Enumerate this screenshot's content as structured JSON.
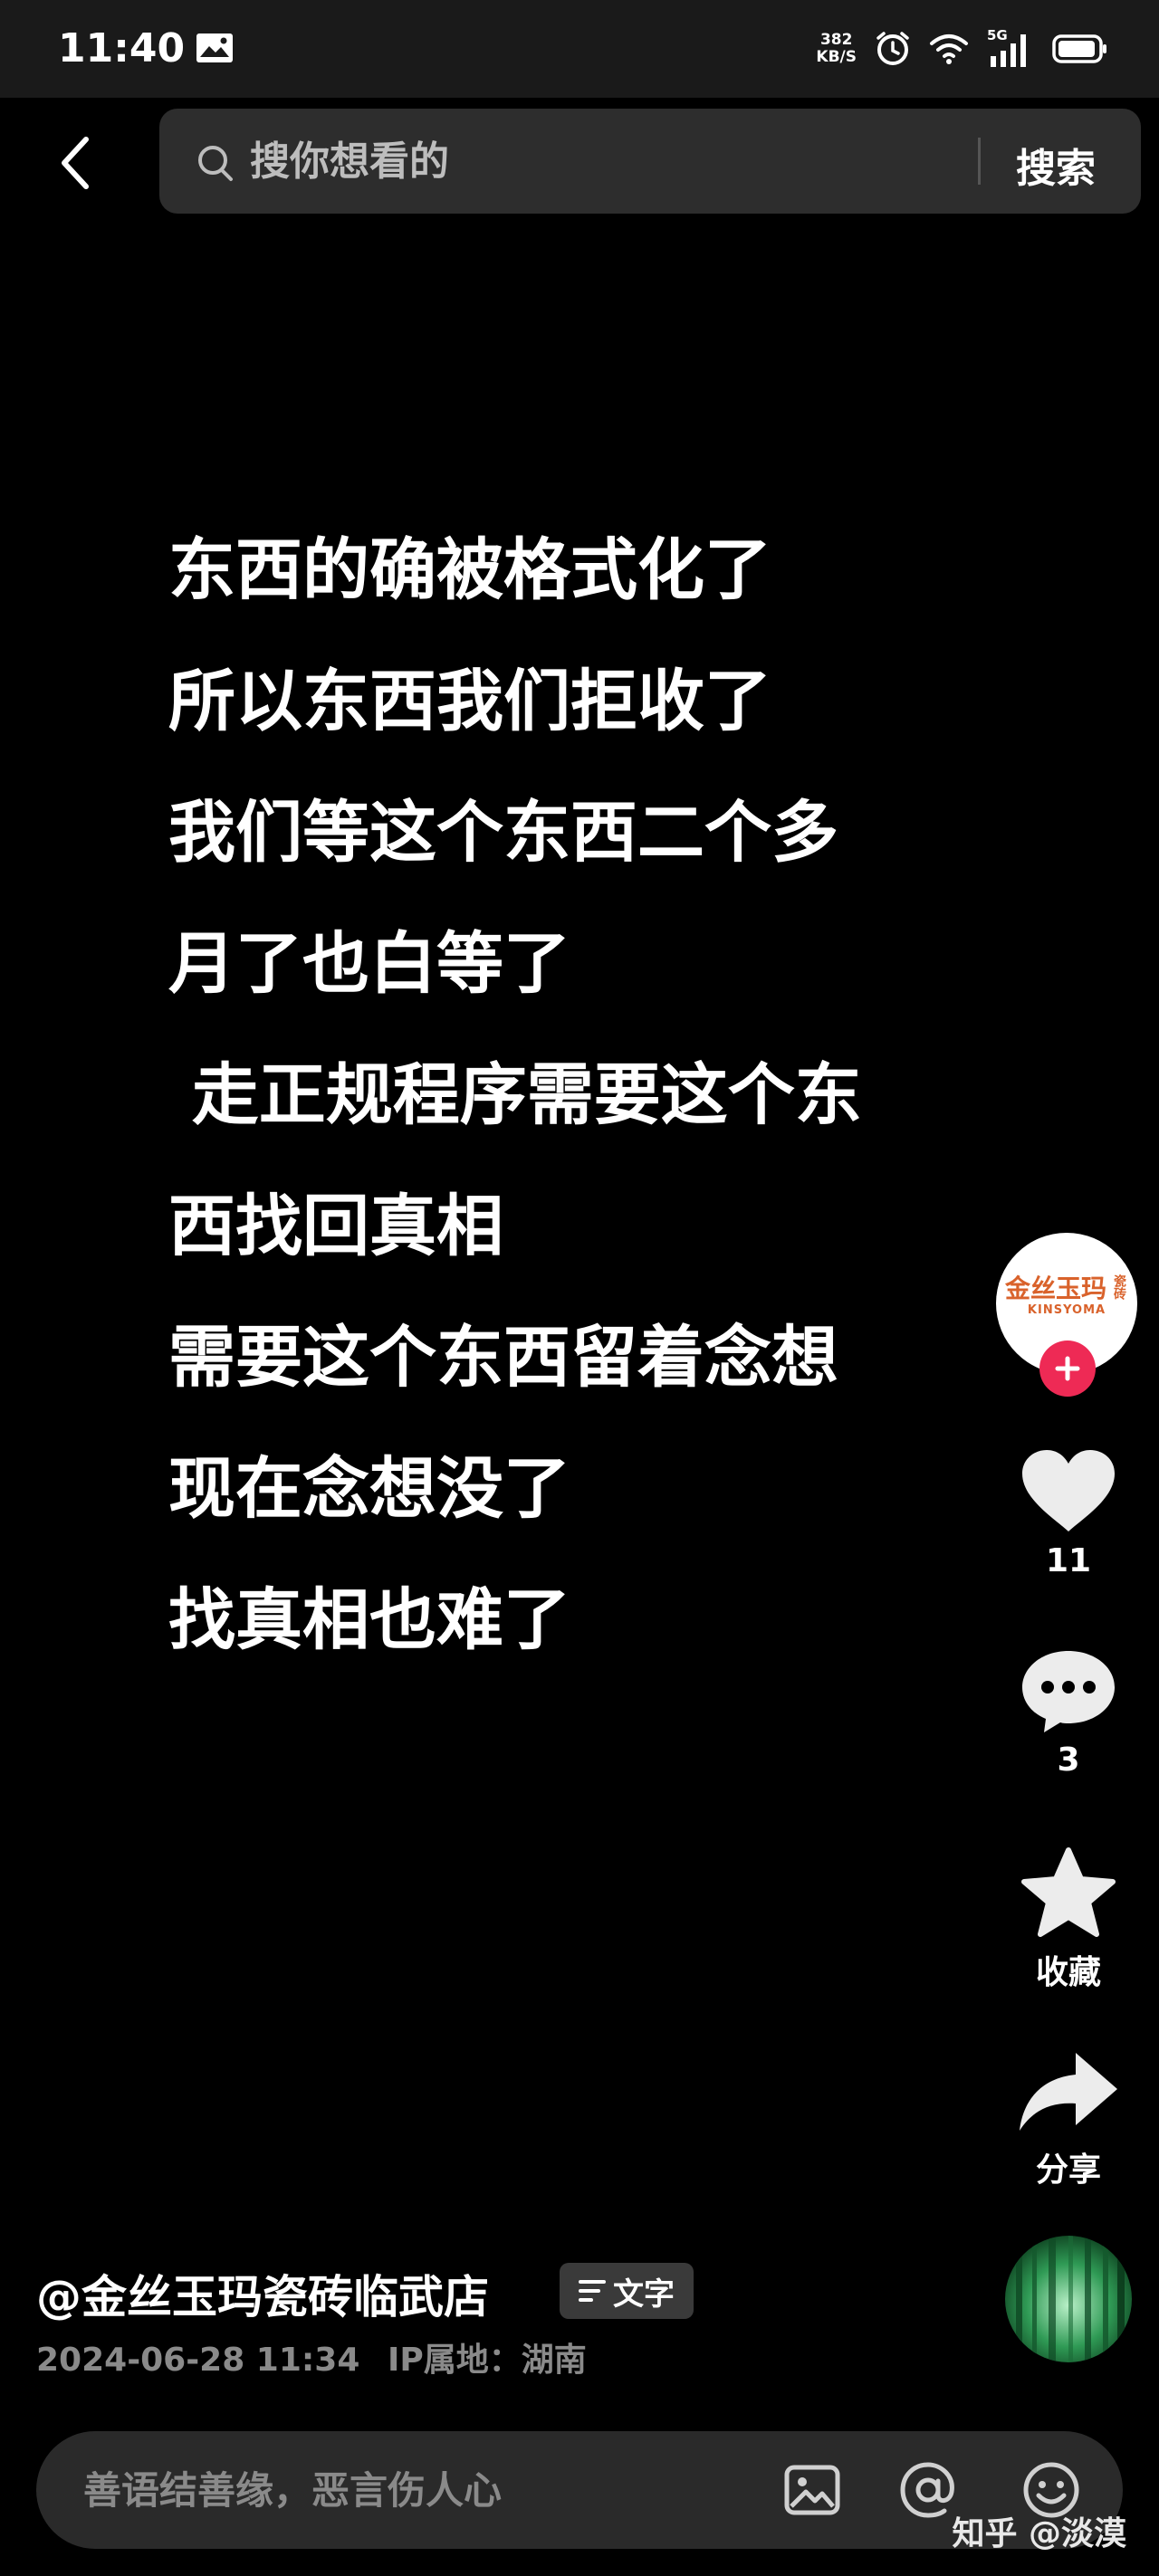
{
  "status_bar": {
    "time": "11:40",
    "net_speed_value": "382",
    "net_speed_unit": "KB/S",
    "network_type": "5G",
    "icons": [
      "gallery-icon",
      "alarm-icon",
      "wifi-icon",
      "signal-icon",
      "battery-icon"
    ]
  },
  "header": {
    "search_placeholder": "搜你想看的",
    "search_button_label": "搜索"
  },
  "content": {
    "lines": [
      "东西的确被格式化了",
      "所以东西我们拒收了",
      "我们等这个东西二个多",
      "月了也白等了",
      " 走正规程序需要这个东",
      "西找回真相",
      "需要这个东西留着念想",
      "现在念想没了",
      "找真相也难了"
    ]
  },
  "sidebar": {
    "avatar_logo_text": "金丝玉玛",
    "avatar_logo_sub": "KINSYOMA",
    "avatar_logo_side": "瓷砖",
    "like_count": "11",
    "comment_count": "3",
    "favorite_label": "收藏",
    "share_label": "分享"
  },
  "video_info": {
    "author": "@金丝玉玛瓷砖临武店",
    "text_tag_label": "文字",
    "date": "2024-06-28 11:34",
    "ip_location": "IP属地：湖南"
  },
  "comment_bar": {
    "placeholder": "善语结善缘，恶言伤人心"
  },
  "watermark": "知乎 @淡漠",
  "colors": {
    "background": "#000000",
    "follow_accent": "#ee2a55",
    "logo_orange": "#d9622b"
  }
}
